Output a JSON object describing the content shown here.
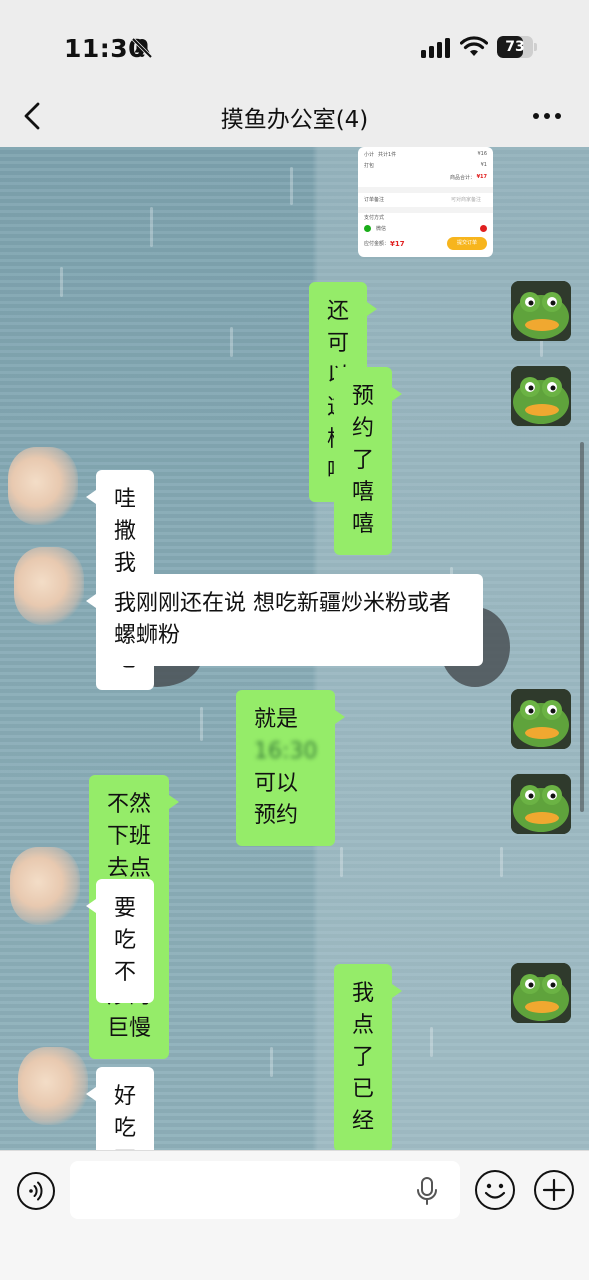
{
  "status_bar": {
    "time": "11:30",
    "battery_level": 73,
    "icons": [
      "bell-off-icon",
      "cellular-signal-icon",
      "wifi-icon",
      "battery-icon"
    ]
  },
  "header": {
    "title": "摸鱼办公室(4)",
    "icons": [
      "back-arrow-icon",
      "more-dots-icon"
    ]
  },
  "colors": {
    "sent_bubble": "#95ec69",
    "received_bubble": "#ffffff",
    "price_red": "#e02020",
    "pay_button": "#f7b51d"
  },
  "order_card": {
    "subtotal_label": "小计",
    "subtotal_detail": "共计1件",
    "subtotal_value": "¥16",
    "packing_label": "打包",
    "packing_value": "¥1",
    "total_label": "商品合计：",
    "total_value": "¥17",
    "remark_label": "订单备注",
    "remark_placeholder": "可对商家备注",
    "payment_method_label": "支付方式",
    "payment_option": "微信",
    "due_label": "应付金额：",
    "due_value": "¥17",
    "submit_label": "提交订单"
  },
  "messages": [
    {
      "side": "right",
      "text": "还可以这样哦"
    },
    {
      "side": "right",
      "text": "预约了嘻嘻"
    },
    {
      "side": "left",
      "text": "哇撒 我也想吃"
    },
    {
      "side": "left",
      "text": "我刚刚还在说 想吃新疆炒米粉或者螺蛳粉"
    },
    {
      "side": "right",
      "text_before": "就是",
      "text_hidden": "16:30",
      "text_after": "可以预约"
    },
    {
      "side": "right",
      "text": "不然下班去点新疆米粉，炒的巨慢"
    },
    {
      "side": "left",
      "text": "要吃不"
    },
    {
      "side": "right",
      "text": "我点了已经"
    },
    {
      "side": "left",
      "text": "好吃不 学校的"
    }
  ],
  "input_bar": {
    "placeholder": "",
    "icons": [
      "voice-icon",
      "mic-icon",
      "emoji-icon",
      "plus-icon"
    ]
  }
}
